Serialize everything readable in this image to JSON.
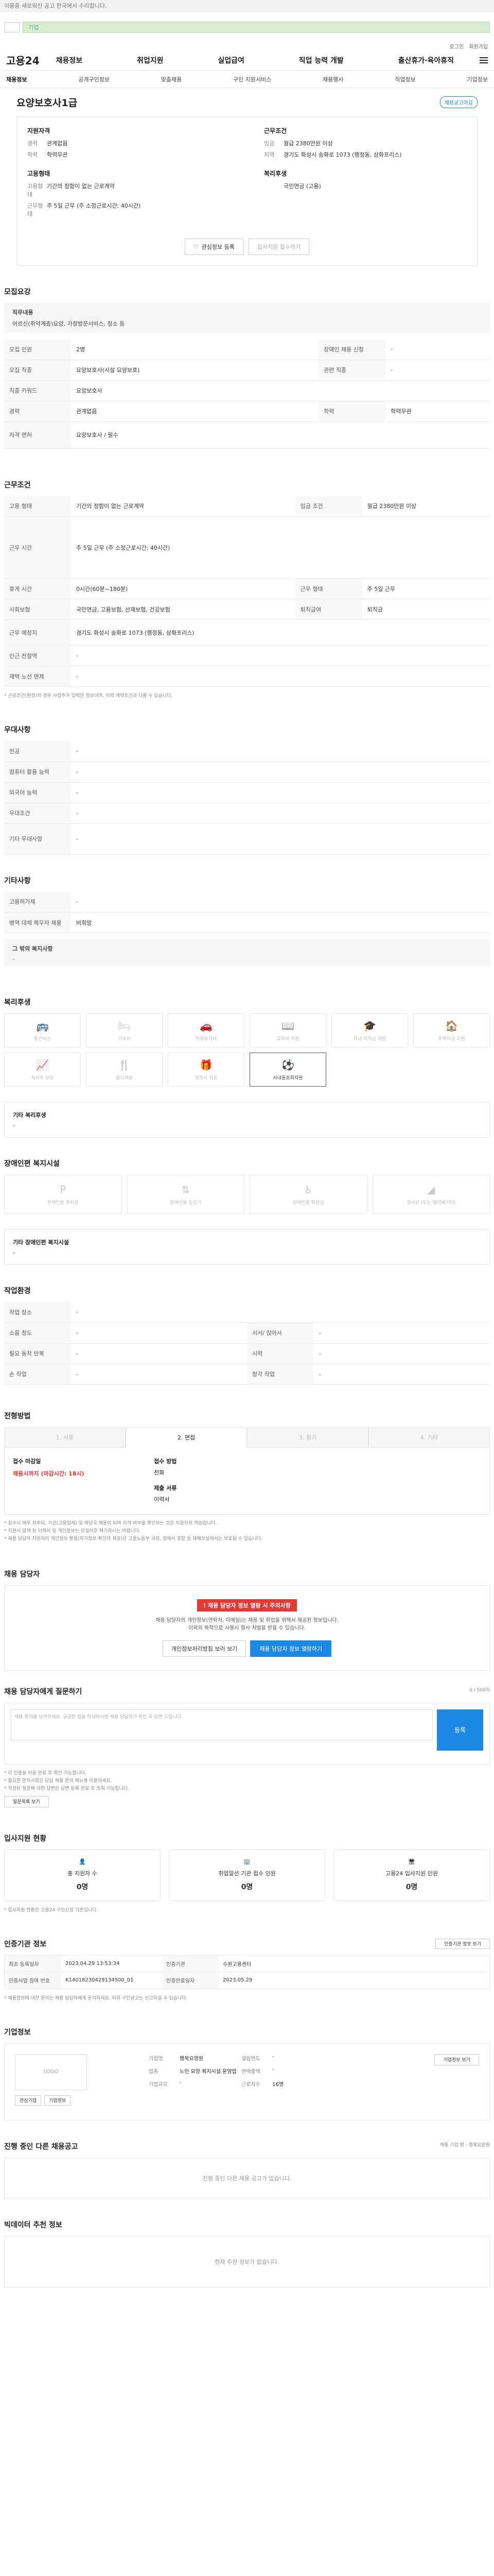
{
  "topbar": {
    "text": "이용중 새로워진 공고 한국에서 수리합니다."
  },
  "header": {
    "search_placeholder": "기업"
  },
  "util": {
    "login": "로그인",
    "signup": "회원가입"
  },
  "gnb": {
    "brand": "고용24",
    "menu": [
      "채용정보",
      "취업지원",
      "실업급여",
      "직업 능력 개발",
      "출산휴가·육아휴직"
    ]
  },
  "subnav": [
    "채용정보",
    "공개구인정보",
    "맞춤채용",
    "구인 지원서비스",
    "채용행사",
    "직업정보",
    "기업정보"
  ],
  "job": {
    "title": "요양보호사1급",
    "badge": "채용공고마감",
    "left_heading": "지원자격",
    "left_rows": [
      {
        "k": "경력",
        "v": "관계없음"
      },
      {
        "k": "학력",
        "v": "학력무관"
      }
    ],
    "left_heading2": "고용형태",
    "left_rows2": [
      {
        "k": "고용형태",
        "v": "기간의 정함이 없는 근로계약"
      },
      {
        "k": "근무형태",
        "v": "주 5일 근무 (주 소정근로시간: 40시간)"
      }
    ],
    "right_heading": "근무조건",
    "right_rows": [
      {
        "k": "임금",
        "v": "월급 2380만원 이상"
      },
      {
        "k": "지역",
        "v": "경기도 화성시 송화로 1073 (행정동, 삼화프리스)"
      }
    ],
    "right_heading2": "복리후생",
    "right_rows2": [
      {
        "k": "",
        "v": "국민연금 (고용)"
      }
    ],
    "action_save": "관심정보 등록",
    "action_apply": "입사지원 접수하기"
  },
  "sections": {
    "recruit": "모집요강",
    "conditions": "근무조건",
    "preferences": "우대사항",
    "etc": "기타사항",
    "welfare": "복리후생",
    "disability": "장애인편 복지시설",
    "workenv": "작업환경",
    "selection": "전형방법",
    "contact": "채용 담당자",
    "inquiry": "채용 담당자에게 질문하기",
    "applicants": "입사지원 현황",
    "certification": "인증기관 정보",
    "company": "기업정보",
    "other_jobs": "진행 중인 다른 채용공고",
    "recommend": "빅데이터 추천 정보"
  },
  "recruit": {
    "job_desc_title": "직무내용",
    "job_desc": "어르신(취약계층)요양, 가정방문서비스, 청소 등",
    "rows": [
      {
        "k": "모집 인원",
        "v": "2명",
        "k2": "장애인 채용 신청",
        "v2": "-"
      },
      {
        "k": "모집 직종",
        "v": "요양보호사(시설 요양보호)",
        "k2": "관련 직종",
        "v2": "-"
      },
      {
        "k": "직종 키워드",
        "v": "요양보호사",
        "k2": "",
        "v2": ""
      },
      {
        "k": "경력",
        "v": "관계없음",
        "k2": "학력",
        "v2": "학력무관"
      },
      {
        "k": "자격 면허",
        "v": "요양보호사 / 필수",
        "k2": "",
        "v2": ""
      }
    ]
  },
  "conditions": {
    "rows": [
      {
        "k": "고용 형태",
        "v": "기간의 정함이 없는 근로계약",
        "k2": "임금 조건",
        "v2": "월급 2380만원 이상"
      },
      {
        "k": "근무 시간",
        "v": "주 5일 근무 (주 소정근로시간: 40시간)",
        "k2": "",
        "v2": ""
      },
      {
        "k": "휴게 시간",
        "v": "0시간(60분~180분)",
        "k2": "근무 형태",
        "v2": "주 5일 근무"
      },
      {
        "k": "사회보험",
        "v": "국민연금, 고용보험, 산재보험, 건강보험",
        "k2": "퇴직급여",
        "v2": "퇴직금"
      },
      {
        "k": "근무 예정지",
        "v": "경기도 화성시 송화로 1073 (행정동, 삼화프리스)",
        "k2": "",
        "v2": ""
      },
      {
        "k": "인근 전철역",
        "v": "-",
        "k2": "",
        "v2": ""
      },
      {
        "k": "재택 노선 면제",
        "v": "-",
        "k2": "",
        "v2": ""
      }
    ],
    "note": "* 근로조건(환경)의 경우 사업주가 입력한 정보이며, 이력 계약조건과 다를 수 있습니다."
  },
  "preferences": {
    "rows": [
      {
        "k": "전공",
        "v": "-"
      },
      {
        "k": "컴퓨터 활용 능력",
        "v": "-"
      },
      {
        "k": "외국어 능력",
        "v": "-"
      },
      {
        "k": "우대조건",
        "v": "-"
      },
      {
        "k": "기타 우대사항",
        "v": "-"
      }
    ]
  },
  "etc": {
    "rows": [
      {
        "k": "고용허가제",
        "v": "-"
      },
      {
        "k": "병역 대체 복무자 채용",
        "v": "비희망"
      }
    ],
    "sub_title": "그 밖의 복지사항",
    "sub_value": "-"
  },
  "welfare": {
    "items": [
      "통근버스",
      "기숙사",
      "차량유지비",
      "교육비 지원",
      "자녀 학자금 지원",
      "주택자금 지원",
      "자사주 보유",
      "중식제공",
      "경조사 지원",
      "사내동호회지원"
    ],
    "active": "사내동호회지원",
    "other_title": "기타 복리후생",
    "other_value": "-"
  },
  "disability": {
    "items": [
      "장애인용 주차장",
      "장애인용 승강기",
      "장애인용 화장실",
      "경사로 (또는 엘리베이터)"
    ],
    "other_title": "기타 장애인편 복지시설",
    "other_value": "-"
  },
  "workenv": {
    "rows": [
      {
        "k": "작업 장소",
        "v": "-",
        "k2": "",
        "v2": ""
      },
      {
        "k": "소음 정도",
        "v": "-",
        "k2": "서서/ 앉아서",
        "v2": "-"
      },
      {
        "k": "필요 동작 반복",
        "v": "-",
        "k2": "시력",
        "v2": "-"
      },
      {
        "k": "손 작업",
        "v": "-",
        "k2": "청각 작업",
        "v2": "-"
      }
    ]
  },
  "selection": {
    "tabs": [
      "1. 서류",
      "2. 면접",
      "3. 필기",
      "4. 기타"
    ],
    "active": "2. 면접",
    "deadline_label": "접수 마감일",
    "deadline_value": "채용시까지 (마감시간: 18시)",
    "method_label": "접수 방법",
    "method_value": "전화",
    "docs_label": "제출 서류",
    "docs_value": "이력서",
    "notes": [
      "* 접수시 매우 자주되, 기관(고용업체) 및 해당국 채용이 되며 자격 여부를 확인하는 것은 지원자의 책임입니다.",
      "* 지원시 알게 된 이력서 및 개인정보는 모집이후 폐기하시는 바랍니다.",
      "* 채용 담당자 지원자의 개인정보 활용(자가정보 확인의 제공)은 고용노동부 국외, 장애시 포함 등 재해보상에서는 보호될 수 있습니다."
    ]
  },
  "contact": {
    "warn": "채용 담당자 정보 열람 시 주의사항",
    "lines": [
      "채용 담당자의 개인정보(연락처, 이메일)는 채용 및 취업을 위해서 제공된 정보입니다.",
      "이외의 목적으로 사용시 형사 처벌을 받을 수 있습니다."
    ],
    "btn_login": "개인정보처리방침 보러 보기",
    "btn_view": "채용 담당자 정보 열람하기"
  },
  "inquiry": {
    "counter": "0 / 500자",
    "placeholder": "채용 문의를 남겨주세요. 궁금한 점을 작성하시면 채용 담당자가 확인 후 답변 드립니다.",
    "submit": "등록",
    "notes": [
      "* 이 인증을 이용 완료 후 확인 가능합니다.",
      "* 중요한 문의사항은 담당 채용 문의 메뉴를 이용하세요.",
      "* 작성된 질문에 대한 답변은 답변 등록 완료 후 조회 가능합니다."
    ],
    "list_btn": "질문목록 보기"
  },
  "applicants": {
    "cards": [
      {
        "label": "총 지원자 수",
        "value": "0명"
      },
      {
        "label": "취업알선 기관 접수 인원",
        "value": "0명"
      },
      {
        "label": "고용24 입사지원 인원",
        "value": "0명"
      }
    ],
    "note": "* 입사지원 현황은 고용24 구인신청 기준입니다."
  },
  "certification": {
    "btn": "인증기관 정보 보기",
    "rows": [
      {
        "k": "최초 등록일자",
        "v": "2023.04.29 13:53:34",
        "k2": "인증기관",
        "v2": "수원고용센터",
        "k3": "",
        "v3": ""
      },
      {
        "k": "인증사업 참여 번호",
        "v": "K14018230429134500_01",
        "k2": "인증만료일자",
        "v2": "2023.05.29",
        "k3": "",
        "v3": ""
      }
    ],
    "note": "* 채용정보에 대한 문의는 채용 담당자에게 문의하세요. 허위 구인공고는 신고하실 수 있습니다."
  },
  "company": {
    "logo": "LOGO",
    "fields": [
      {
        "k": "기업명",
        "v": "행복요양원"
      },
      {
        "k": "업종",
        "v": "노인 요양 복지시설 운영업"
      },
      {
        "k": "기업규모",
        "v": "-"
      },
      {
        "k": "설립연도",
        "v": "-"
      },
      {
        "k": "연매출액",
        "v": "-"
      },
      {
        "k": "근로자수",
        "v": "16명"
      }
    ],
    "btn_detail": "기업정보 보기",
    "btn_a": "관심기업",
    "btn_b": "기업정보"
  },
  "other_jobs": {
    "sub": "채용 기업 명 : 행복요양원",
    "empty": "진행 중인 다른 채용 공고가 없습니다."
  },
  "recommend": {
    "empty": "현재 추천 정보가 없습니다."
  }
}
